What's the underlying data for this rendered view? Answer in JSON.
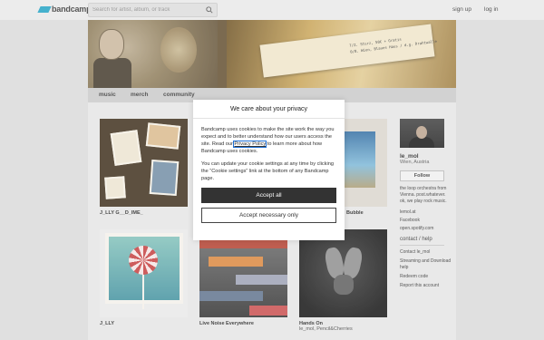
{
  "header": {
    "logo_text": "bandcamp",
    "search_placeholder": "Search for artist, album, or track",
    "signup_label": "sign up",
    "login_label": "log in"
  },
  "banner": {
    "ticket_line_1": "T/Z. Sturz, 50€ + Gratis",
    "ticket_line_2": "0/8. Wien, Blaues Haus / d.g. Drahtwalle"
  },
  "tabs": [
    "music",
    "merch",
    "community"
  ],
  "albums": [
    {
      "title": "J_LLY G__D_IME_",
      "artist": ""
    },
    {
      "title": "Bubble",
      "artist": ""
    },
    {
      "title": "J_LLY",
      "artist": ""
    },
    {
      "title": "Live Noise Everywhere",
      "artist": ""
    },
    {
      "title": "Hands On",
      "artist": "le_mol, Pencil&Cherries"
    }
  ],
  "sidebar": {
    "name": "le_mol",
    "location": "Wien, Austria",
    "follow_label": "Follow",
    "bio": "the loop orchestra from Vienna. post.whatever. ok, we play rock music.",
    "links": [
      "lemol.at",
      "Facebook",
      "open.spotify.com"
    ],
    "contact_heading": "contact / help",
    "contact_items": [
      "Contact le_mol",
      "Streaming and Download help",
      "Redeem code",
      "Report this account"
    ]
  },
  "cookie_dialog": {
    "title": "We care about your privacy",
    "p1_before": "Bandcamp uses cookies to make the site work the way you expect and to better understand how our users access the site. Read our ",
    "p1_link": "Privacy Policy",
    "p1_after": " to learn more about how Bandcamp uses cookies.",
    "p2": "You can update your cookie settings at any time by clicking the “Cookie settings” link at the bottom of any Bandcamp page.",
    "accept_all_label": "Accept all",
    "accept_necessary_label": "Accept necessary only"
  },
  "colors": {
    "logo_accent": "#1da0c3",
    "primary_button": "#333333"
  }
}
